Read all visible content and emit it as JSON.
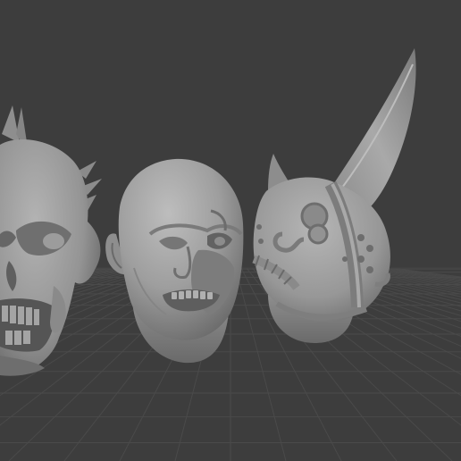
{
  "viewport": {
    "kind": "3d-viewport",
    "grid": true,
    "background_color": "#3d3d3d",
    "grid_line_color": "#4a4a4a",
    "grid_horizon_color": "#434343"
  },
  "objects": [
    {
      "name": "spiked-skull-head",
      "material_color": "#9d9d9d",
      "partially_visible": true
    },
    {
      "name": "bald-zombie-head",
      "material_color": "#a2a2a2",
      "partially_visible": false
    },
    {
      "name": "horned-helmet-head",
      "material_color": "#9e9e9e",
      "partially_visible": false
    }
  ]
}
